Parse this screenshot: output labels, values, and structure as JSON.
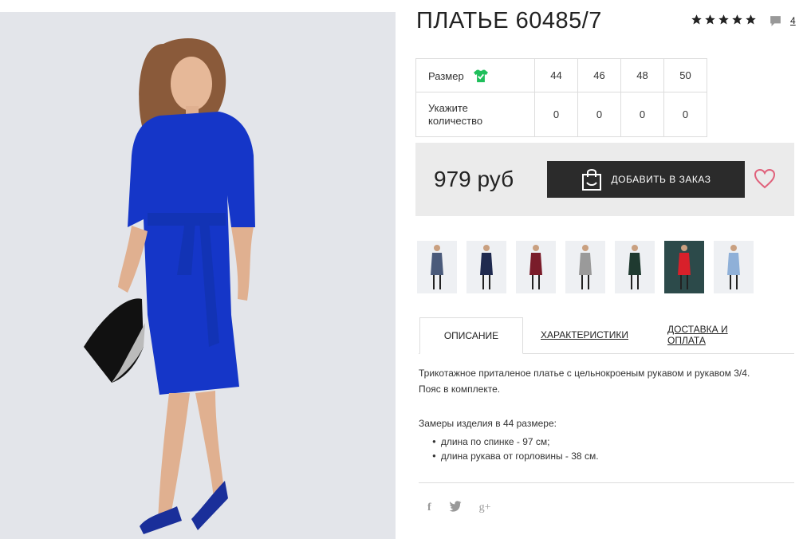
{
  "product": {
    "title": "ПЛАТЬЕ 60485/7",
    "rating": 5,
    "comments_count": "4"
  },
  "sizes": {
    "label": "Размер",
    "values": [
      "44",
      "46",
      "48",
      "50"
    ],
    "qty_label_1": "Укажите",
    "qty_label_2": "количество",
    "quantities": [
      "0",
      "0",
      "0",
      "0"
    ]
  },
  "buy": {
    "price": "979 руб",
    "add_button": "ДОБАВИТЬ В ЗАКАЗ"
  },
  "thumbnails": [
    {
      "color": "#4a5a7a"
    },
    {
      "color": "#1f2a4f"
    },
    {
      "color": "#7a1c2a"
    },
    {
      "color": "#9a9a9a"
    },
    {
      "color": "#1f3a30"
    },
    {
      "color": "#d8202a"
    },
    {
      "color": "#8fb0d8"
    }
  ],
  "tabs": {
    "description": "ОПИСАНИЕ",
    "specs": "ХАРАКТЕРИСТИКИ",
    "delivery": "ДОСТАВКА И ОПЛАТА"
  },
  "description": {
    "line1": "Трикотажное приталеное платье с цельнокроеным рукавом и рукавом 3/4.",
    "line2": "Пояс в комплекте.",
    "measurements_title": "Замеры изделия в 44 размере:",
    "measurements": [
      "длина по спинке - 97 см;",
      "длина рукава от горловины - 38 см."
    ]
  },
  "social": [
    "f",
    "t",
    "g+"
  ],
  "colors": {
    "accent_green": "#1fbf5b",
    "dress_blue": "#1536c8",
    "heart_pink": "#e0607a",
    "button_dark": "#2b2b2b"
  }
}
